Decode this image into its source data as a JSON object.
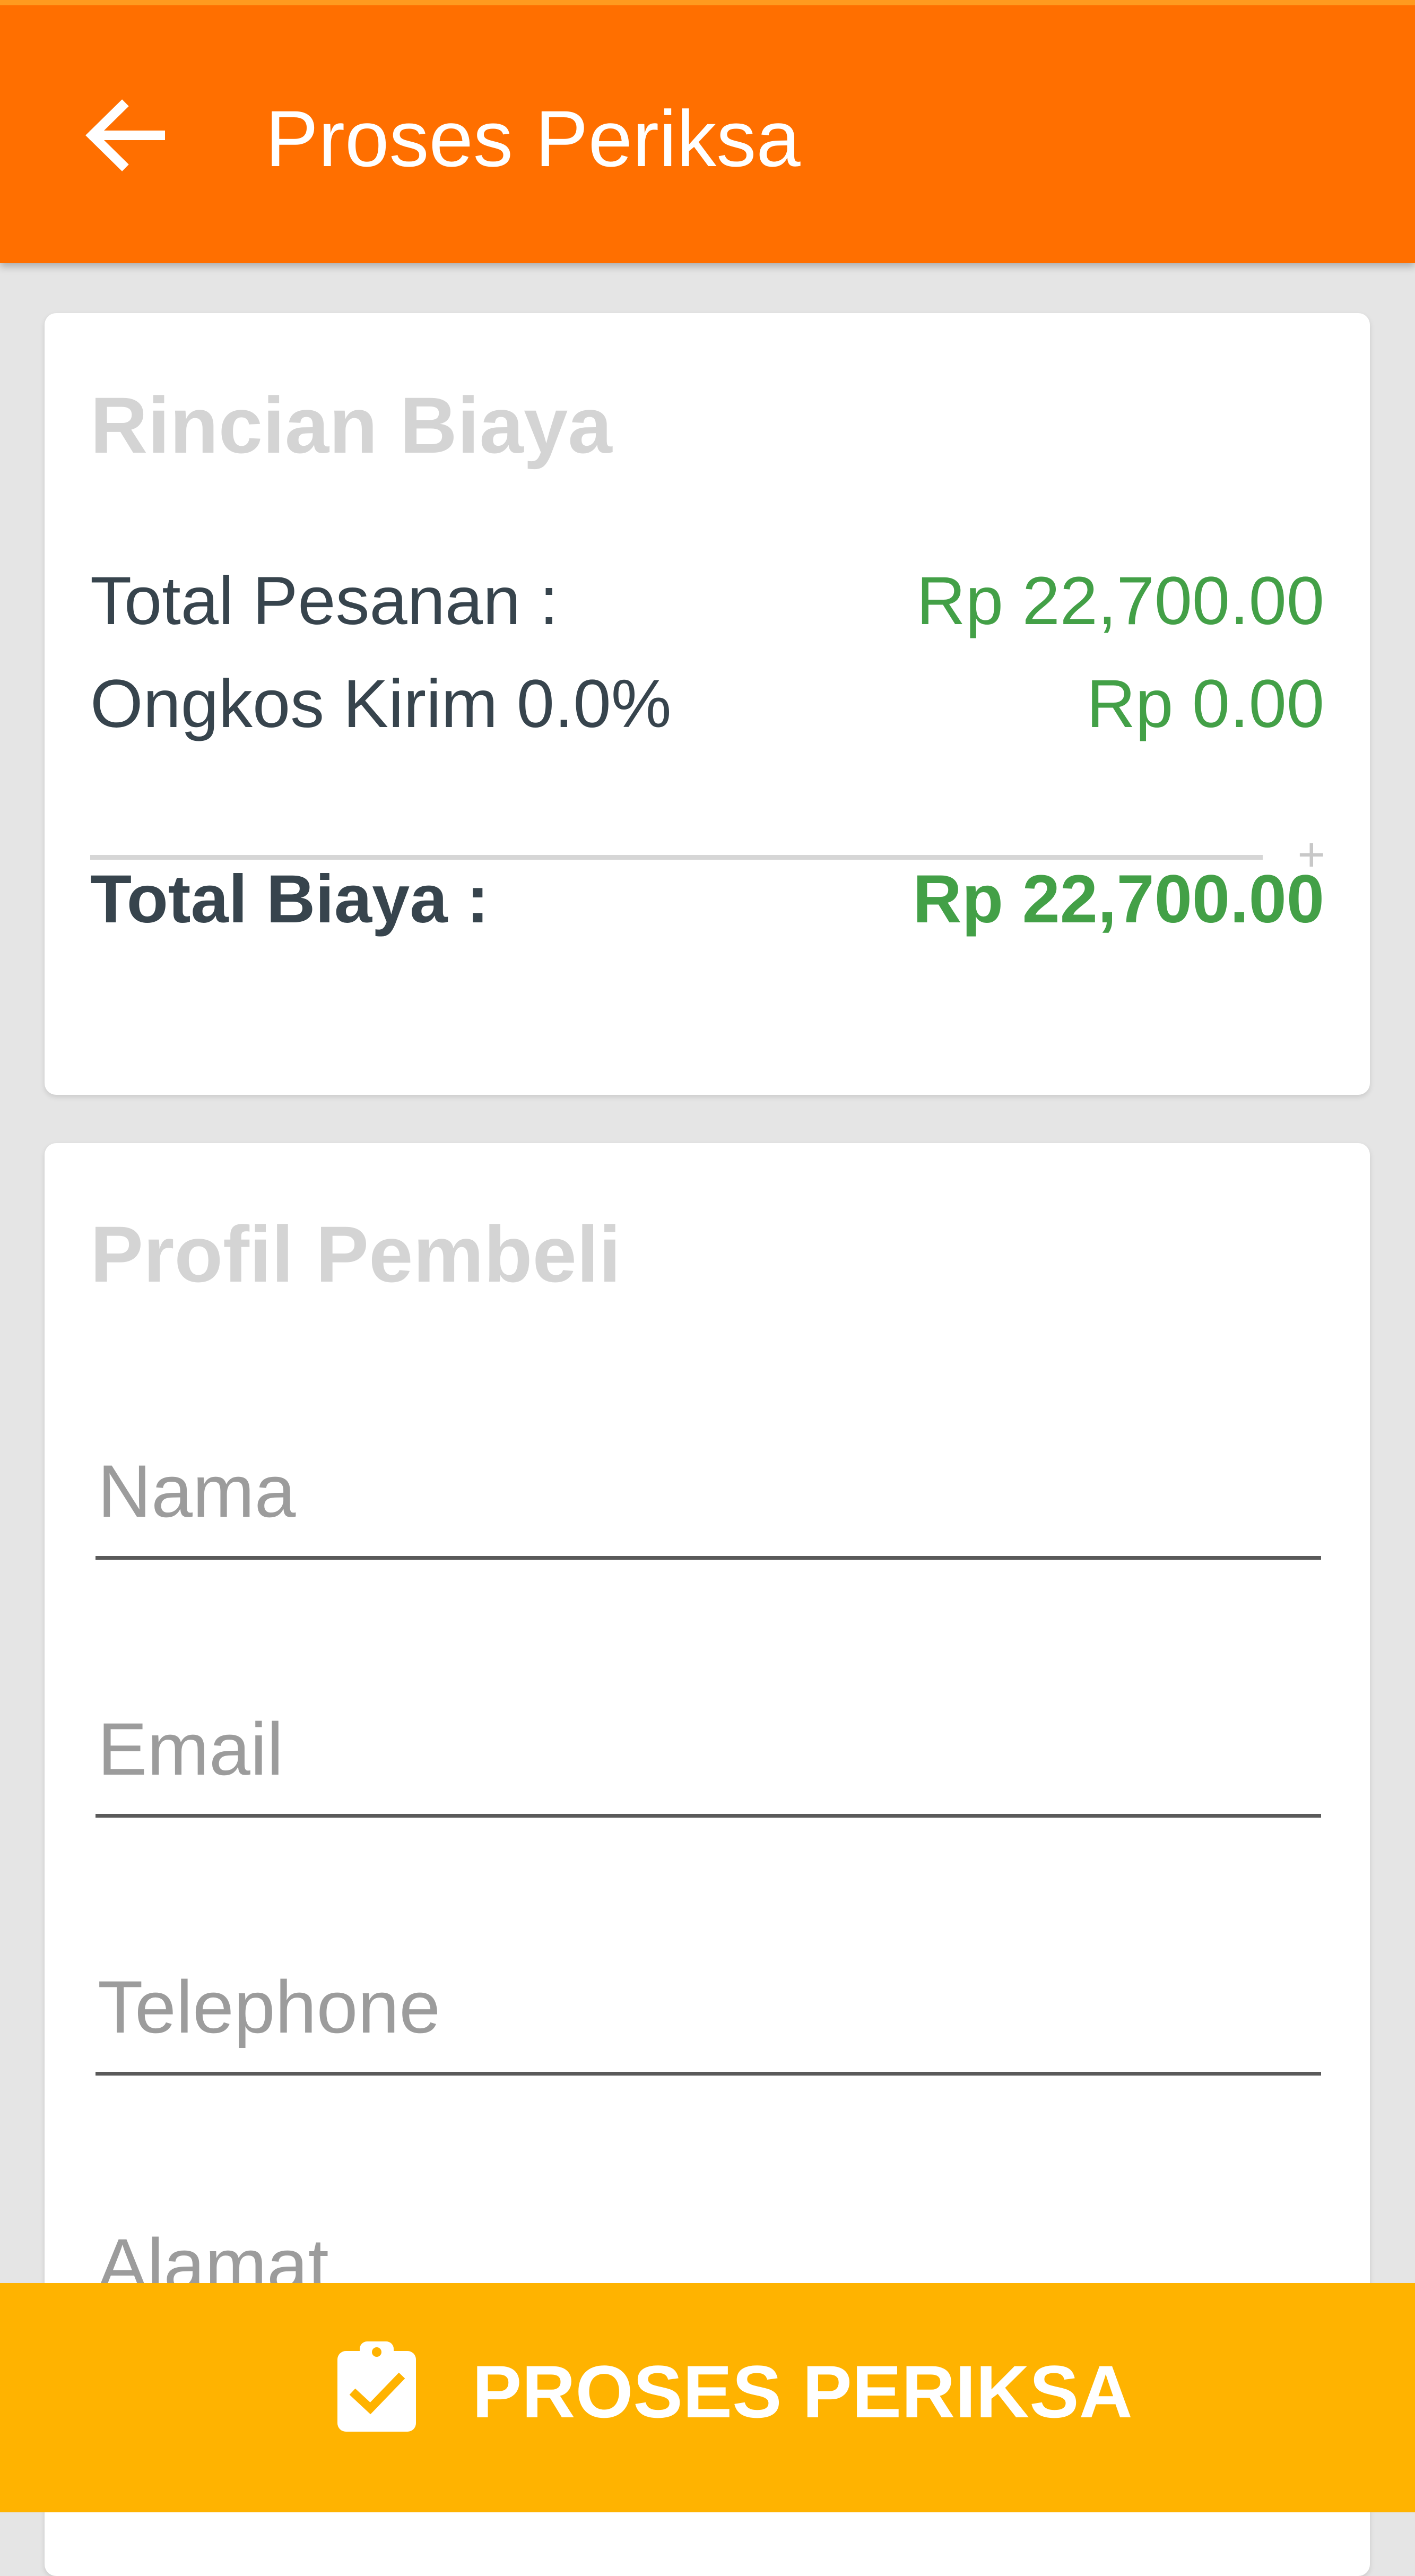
{
  "header": {
    "title": "Proses Periksa",
    "back_icon": "arrow-left-icon",
    "color": "#ff6f00"
  },
  "cost_details": {
    "title": "Rincian Biaya",
    "order_total_label": "Total Pesanan :",
    "order_total_value": "Rp 22,700.00",
    "shipping_label": "Ongkos Kirim 0.0%",
    "shipping_value": "Rp 0.00",
    "sum_symbol": "+",
    "grand_total_label": "Total Biaya :",
    "grand_total_value": "Rp 22,700.00",
    "value_color": "#43a047"
  },
  "buyer_profile": {
    "title": "Profil Pembeli",
    "fields": {
      "name_placeholder": "Nama",
      "email_placeholder": "Email",
      "phone_placeholder": "Telephone",
      "address_placeholder": "Alamat"
    }
  },
  "footer": {
    "button_label": "PROSES PERIKSA",
    "button_icon": "clipboard-check-icon",
    "color": "#ffb300"
  }
}
